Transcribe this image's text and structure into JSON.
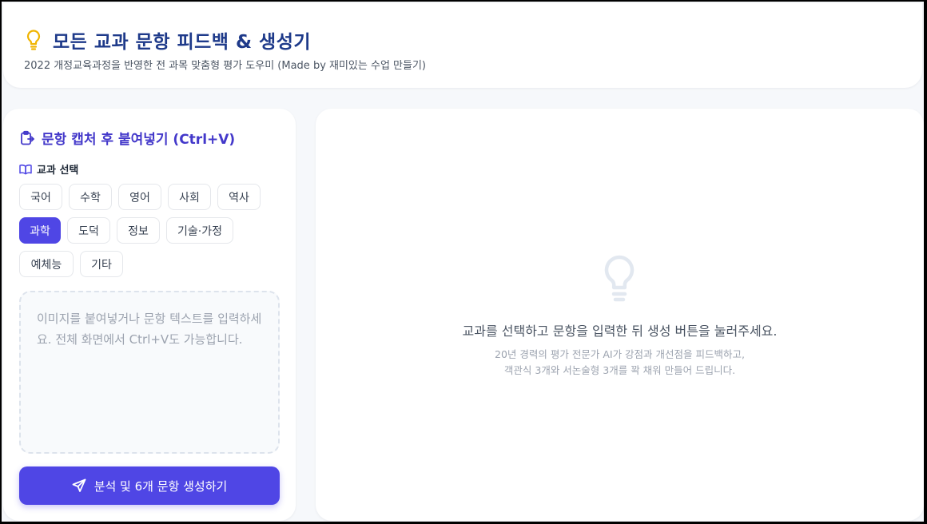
{
  "header": {
    "title": "모든 교과 문항 피드백 & 생성기",
    "subtitle": "2022 개정교육과정을 반영한 전 과목 맞춤형 평가 도우미 (Made by 재미있는 수업 만들기)",
    "icon": "lightbulb-icon",
    "icon_color": "#f0b400"
  },
  "left_panel": {
    "title": "문항 캡처 후 붙여넣기 (Ctrl+V)",
    "title_icon": "clipboard-paste-icon",
    "subject_label": "교과 선택",
    "subject_icon": "book-open-icon",
    "subjects": [
      "국어",
      "수학",
      "영어",
      "사회",
      "역사",
      "과학",
      "도덕",
      "정보",
      "기술·가정",
      "예체능",
      "기타"
    ],
    "selected_subject": "과학",
    "input_placeholder": "이미지를 붙여넣거나 문항 텍스트를 입력하세요. 전체 화면에서 Ctrl+V도 가능합니다.",
    "generate_button": "분석 및 6개 문항 생성하기",
    "generate_icon": "send-icon",
    "accent_color": "#4f46e5"
  },
  "right_panel": {
    "empty_icon": "lightbulb-icon",
    "message": "교과를 선택하고 문항을 입력한 뒤 생성 버튼을 눌러주세요.",
    "sub_message_1": "20년 경력의 평가 전문가 AI가 강점과 개선점을 피드백하고,",
    "sub_message_2": "객관식 3개와 서논술형 3개를 꽉 채워 만들어 드립니다."
  }
}
